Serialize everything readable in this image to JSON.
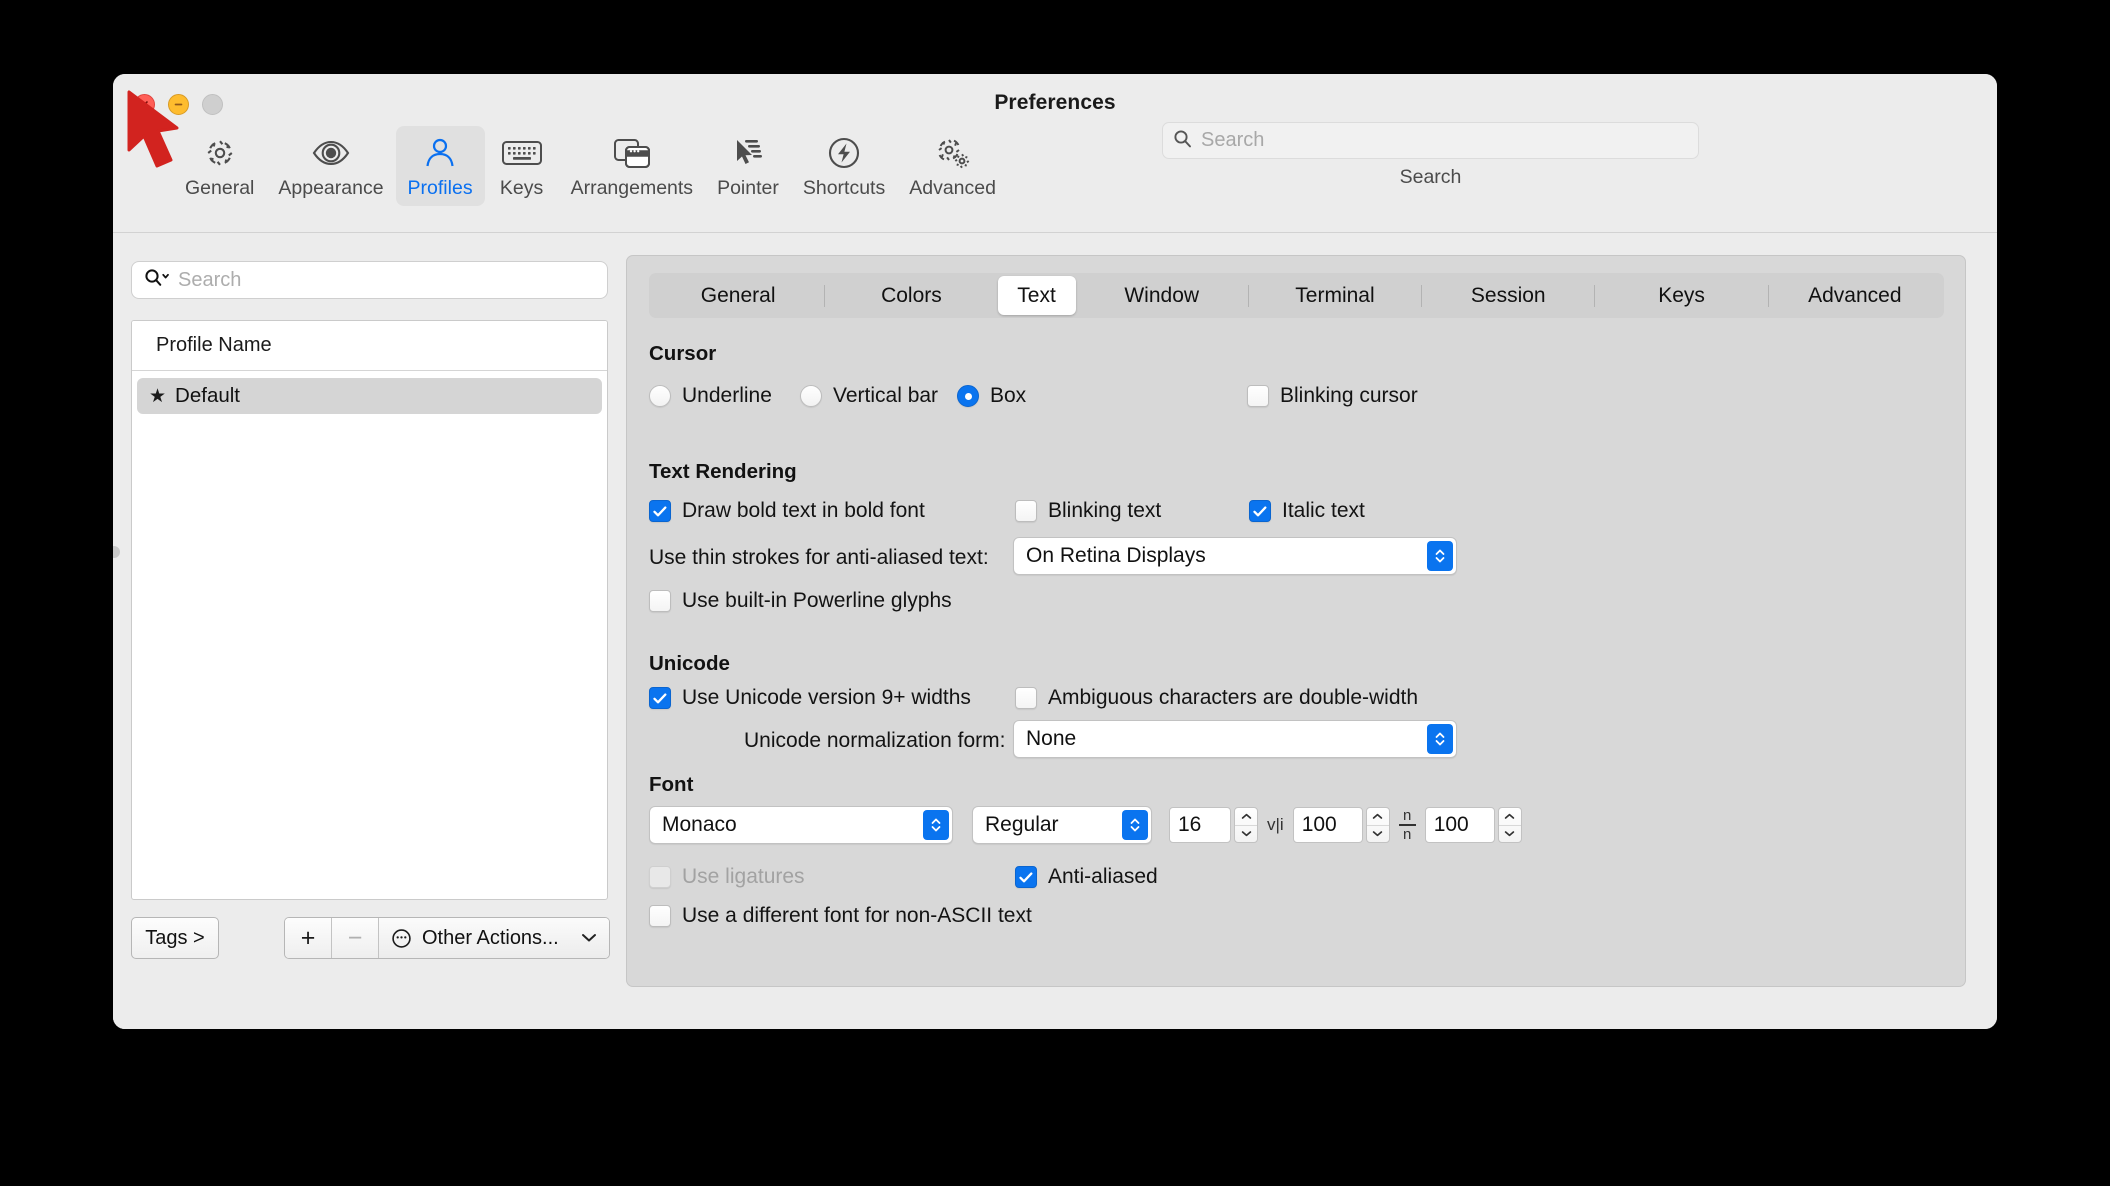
{
  "window": {
    "title": "Preferences",
    "traffic_lights": [
      "close-button",
      "minimize-button",
      "zoom-button"
    ]
  },
  "toolbar": {
    "items": [
      {
        "label": "General",
        "icon": "gear-icon",
        "selected": false
      },
      {
        "label": "Appearance",
        "icon": "eye-icon",
        "selected": false
      },
      {
        "label": "Profiles",
        "icon": "person-icon",
        "selected": true
      },
      {
        "label": "Keys",
        "icon": "keyboard-icon",
        "selected": false
      },
      {
        "label": "Arrangements",
        "icon": "windows-icon",
        "selected": false
      },
      {
        "label": "Pointer",
        "icon": "cursor-arrow-icon",
        "selected": false
      },
      {
        "label": "Shortcuts",
        "icon": "bolt-circle-icon",
        "selected": false
      },
      {
        "label": "Advanced",
        "icon": "gears-icon",
        "selected": false
      }
    ],
    "search": {
      "placeholder": "Search",
      "value": "",
      "caption": "Search",
      "icon": "search-icon"
    }
  },
  "sidebar": {
    "search": {
      "placeholder": "Search",
      "value": "",
      "icon": "search-icon"
    },
    "list": {
      "header": "Profile Name",
      "rows": [
        {
          "name": "Default",
          "starred": true,
          "selected": true
        }
      ]
    },
    "footer": {
      "tags_label": "Tags >",
      "add_label": "+",
      "remove_label": "−",
      "other_actions_label": "Other Actions...",
      "other_actions_icon": "ellipsis-circle-icon",
      "chevron": "chevron-down-icon"
    }
  },
  "pane": {
    "tabs": [
      {
        "label": "General",
        "selected": false
      },
      {
        "label": "Colors",
        "selected": false
      },
      {
        "label": "Text",
        "selected": true
      },
      {
        "label": "Window",
        "selected": false
      },
      {
        "label": "Terminal",
        "selected": false
      },
      {
        "label": "Session",
        "selected": false
      },
      {
        "label": "Keys",
        "selected": false
      },
      {
        "label": "Advanced",
        "selected": false
      }
    ],
    "cursor": {
      "title": "Cursor",
      "options": [
        {
          "label": "Underline",
          "checked": false
        },
        {
          "label": "Vertical bar",
          "checked": false
        },
        {
          "label": "Box",
          "checked": true
        }
      ],
      "blinking": {
        "label": "Blinking cursor",
        "checked": false
      }
    },
    "text_rendering": {
      "title": "Text Rendering",
      "bold": {
        "label": "Draw bold text in bold font",
        "checked": true
      },
      "blinking_text": {
        "label": "Blinking text",
        "checked": false
      },
      "italic_text": {
        "label": "Italic text",
        "checked": true
      },
      "thin_strokes": {
        "label": "Use thin strokes for anti-aliased text:",
        "value": "On Retina Displays"
      },
      "powerline": {
        "label": "Use built-in Powerline glyphs",
        "checked": false
      }
    },
    "unicode": {
      "title": "Unicode",
      "v9_widths": {
        "label": "Use Unicode version 9+ widths",
        "checked": true
      },
      "ambiguous": {
        "label": "Ambiguous characters are double-width",
        "checked": false
      },
      "normalization": {
        "label": "Unicode normalization form:",
        "value": "None"
      }
    },
    "font": {
      "title": "Font",
      "family": "Monaco",
      "style": "Regular",
      "size": "16",
      "horizontal_spacing": {
        "glyph": "v|i",
        "value": "100",
        "icon": "horizontal-spacing-icon"
      },
      "vertical_spacing": {
        "numerator": "n",
        "denominator": "n",
        "value": "100",
        "icon": "vertical-spacing-icon"
      },
      "ligatures": {
        "label": "Use ligatures",
        "checked": false,
        "disabled": true
      },
      "antialiased": {
        "label": "Anti-aliased",
        "checked": true
      },
      "non_ascii": {
        "label": "Use a different font for non-ASCII text",
        "checked": false
      }
    }
  },
  "colors": {
    "accent": "#0a74ef",
    "selected_tab_text": "#0a70f0",
    "close": "#ff5f57",
    "minimize": "#febc2e",
    "zoom": "#cfcfcf",
    "cursor_arrow": "#d2231f"
  }
}
